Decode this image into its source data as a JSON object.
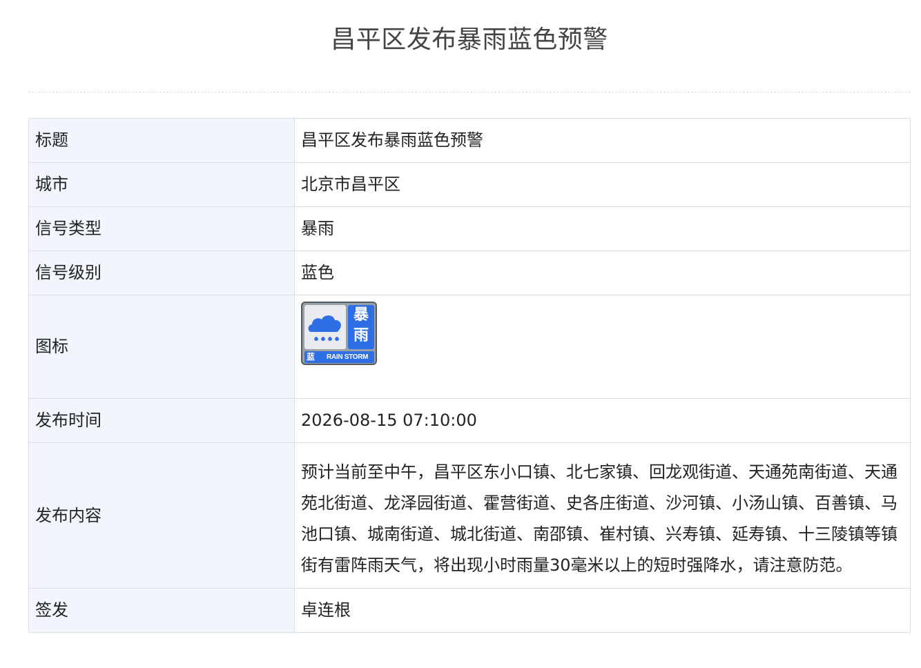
{
  "page_title": "昌平区发布暴雨蓝色预警",
  "rows": [
    {
      "label": "标题",
      "value": "昌平区发布暴雨蓝色预警"
    },
    {
      "label": "城市",
      "value": "北京市昌平区"
    },
    {
      "label": "信号类型",
      "value": "暴雨"
    },
    {
      "label": "信号级别",
      "value": "蓝色"
    },
    {
      "label": "图标"
    },
    {
      "label": "发布时间",
      "value": "2026-08-15 07:10:00"
    },
    {
      "label": "发布内容",
      "value": "预计当前至中午，昌平区东小口镇、北七家镇、回龙观街道、天通苑南街道、天通苑北街道、龙泽园街道、霍营街道、史各庄街道、沙河镇、小汤山镇、百善镇、马池口镇、城南街道、城北街道、南邵镇、崔村镇、兴寿镇、延寿镇、十三陵镇等镇街有雷阵雨天气，将出现小时雨量30毫米以上的短时强降水，请注意防范。"
    },
    {
      "label": "签发",
      "value": "卓连根"
    }
  ],
  "icon": {
    "name": "rainstorm-blue-warning-icon",
    "title_char_1": "暴",
    "title_char_2": "雨",
    "level_char": "蓝",
    "english_label": "RAIN STORM",
    "color_blue": "#2f6fe6",
    "color_frame": "#9aa0a8"
  }
}
